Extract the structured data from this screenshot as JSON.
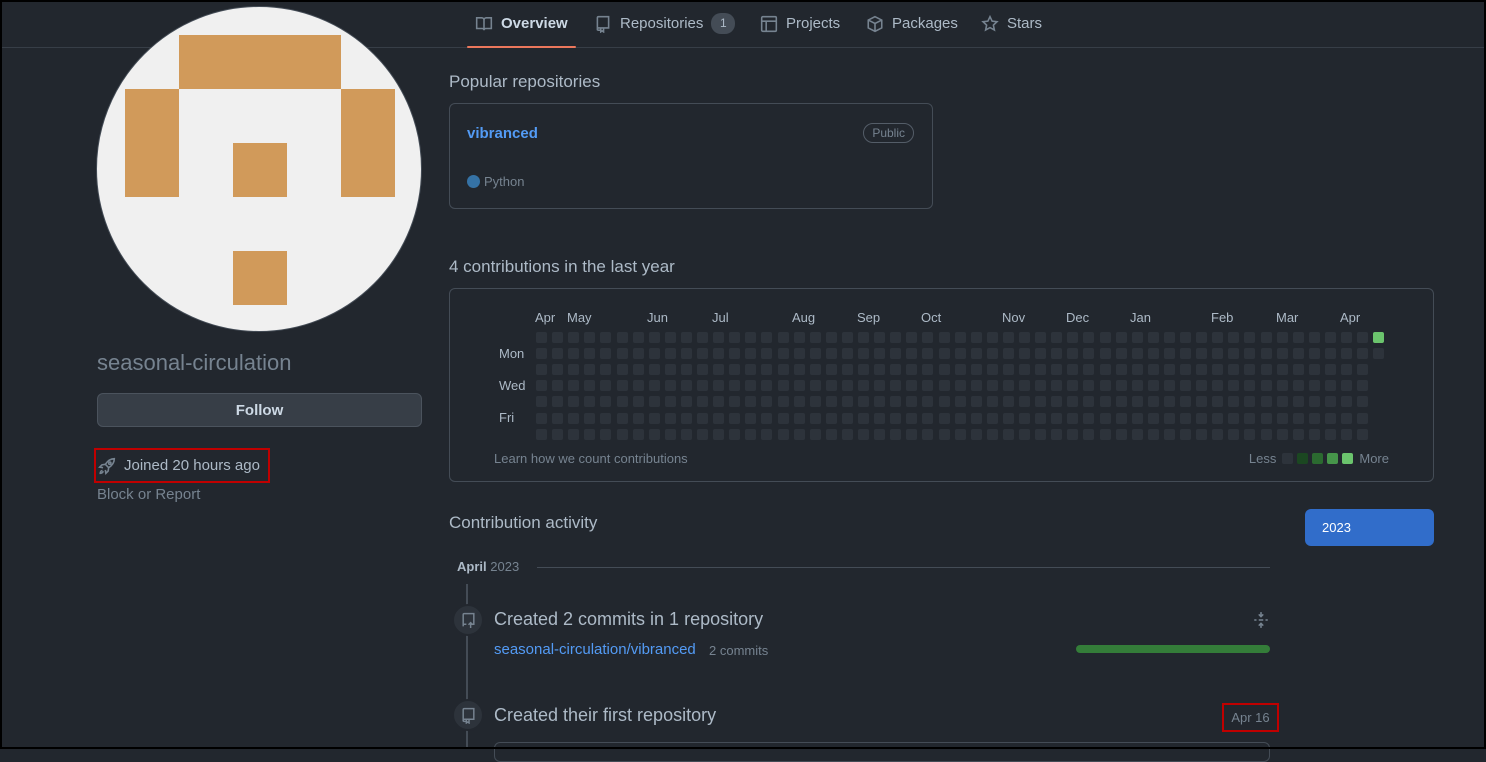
{
  "tabs": [
    {
      "label": "Overview",
      "icon": "book-icon",
      "active": true
    },
    {
      "label": "Repositories",
      "icon": "repo-icon",
      "count": "1"
    },
    {
      "label": "Projects",
      "icon": "table-icon"
    },
    {
      "label": "Packages",
      "icon": "package-icon"
    },
    {
      "label": "Stars",
      "icon": "star-icon"
    }
  ],
  "profile": {
    "username": "seasonal-circulation",
    "follow_label": "Follow",
    "joined": "Joined 20 hours ago",
    "block_report": "Block or Report",
    "avatar_color": "#d19a5a"
  },
  "popular": {
    "title": "Popular repositories",
    "repo": {
      "name": "vibranced",
      "visibility": "Public",
      "language": "Python",
      "language_color": "#3572a5"
    }
  },
  "contributions": {
    "title": "4 contributions in the last year",
    "months": [
      "Apr",
      "May",
      "Jun",
      "Jul",
      "Aug",
      "Sep",
      "Oct",
      "Nov",
      "Dec",
      "Jan",
      "Feb",
      "Mar",
      "Apr"
    ],
    "days": [
      "Mon",
      "Wed",
      "Fri"
    ],
    "learn_text": "Learn how we count contributions",
    "legend_less": "Less",
    "legend_more": "More",
    "legend_colors": [
      "#2d333b",
      "#1b4721",
      "#2b6a30",
      "#46954a",
      "#6bc46d"
    ]
  },
  "activity": {
    "title": "Contribution activity",
    "year_button": "2023",
    "month": "April",
    "year": "2023",
    "events": [
      {
        "title": "Created 2 commits in 1 repository",
        "repo_link": "seasonal-circulation/vibranced",
        "count": "2 commits",
        "icon": "repo-push-icon"
      },
      {
        "title": "Created their first repository",
        "date": "Apr 16",
        "icon": "repo-icon"
      }
    ]
  }
}
